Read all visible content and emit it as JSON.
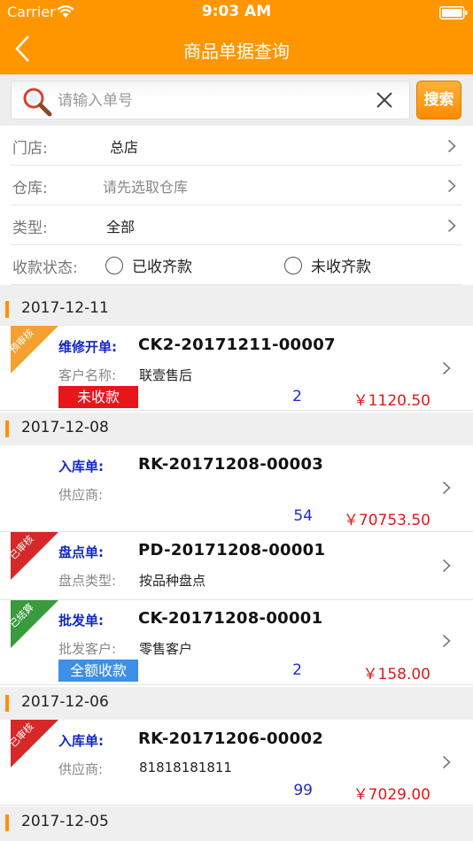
{
  "status_bar": {
    "carrier": "Carrier",
    "time": "9:03 AM"
  },
  "nav": {
    "title": "商品单据查询",
    "back_icon": "chevron-left-icon"
  },
  "search": {
    "placeholder": "请输入单号",
    "value": "",
    "button_label": "搜索"
  },
  "filters": {
    "store": {
      "label": "门店:",
      "value": "总店"
    },
    "warehouse": {
      "label": "仓库:",
      "placeholder": "请先选取仓库"
    },
    "type": {
      "label": "类型:",
      "value": "全部"
    },
    "payment_status": {
      "label": "收款状态:",
      "options": [
        "已收齐款",
        "未收齐款"
      ]
    }
  },
  "colors": {
    "accent": "#ff9600",
    "doc_type": "#1428c8",
    "amount": "#e11818",
    "qty": "#1a2bd0",
    "badge_unpaid": "#e8151b",
    "badge_paid": "#3d8fe8",
    "ribbon_pending": "#f5a030",
    "ribbon_reviewed": "#d62828",
    "ribbon_settled": "#3a9a3e"
  },
  "groups": [
    {
      "date": "2017-12-11",
      "records": [
        {
          "ribbon": "预审核",
          "doc_type": "维修开单:",
          "doc_no": "CK2-20171211-00007",
          "field_label": "客户名称:",
          "field_value": "联壹售后",
          "badge": "未收款",
          "qty": "2",
          "amount": "￥1120.50"
        }
      ]
    },
    {
      "date": "2017-12-08",
      "records": [
        {
          "ribbon": "",
          "doc_type": "入库单:",
          "doc_no": "RK-20171208-00003",
          "field_label": "供应商:",
          "field_value": "",
          "badge": "",
          "qty": "54",
          "amount": "￥70753.50"
        },
        {
          "ribbon": "已审核",
          "doc_type": "盘点单:",
          "doc_no": "PD-20171208-00001",
          "field_label": "盘点类型:",
          "field_value": "按品种盘点",
          "badge": "",
          "qty": "",
          "amount": ""
        },
        {
          "ribbon": "已结算",
          "doc_type": "批发单:",
          "doc_no": "CK-20171208-00001",
          "field_label": "批发客户:",
          "field_value": "零售客户",
          "badge": "全额收款",
          "qty": "2",
          "amount": "￥158.00"
        }
      ]
    },
    {
      "date": "2017-12-06",
      "records": [
        {
          "ribbon": "已审核",
          "doc_type": "入库单:",
          "doc_no": "RK-20171206-00002",
          "field_label": "供应商:",
          "field_value": "81818181811",
          "badge": "",
          "qty": "99",
          "amount": "￥7029.00"
        }
      ]
    },
    {
      "date": "2017-12-05",
      "records": []
    }
  ]
}
